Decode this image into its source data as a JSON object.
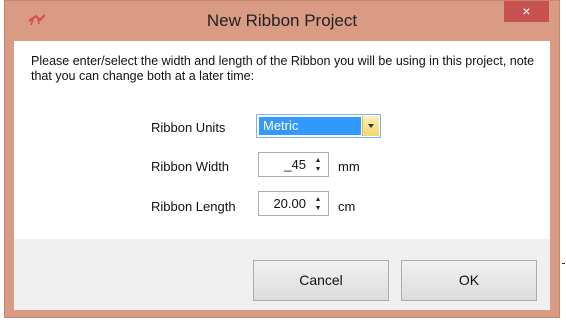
{
  "window": {
    "title": "New Ribbon Project",
    "close_label": "×",
    "frame_color": "#d99b83",
    "close_color": "#c75050"
  },
  "instructions": "Please enter/select the width and length of the Ribbon you will be using in this project, note that you can change both at a later time:",
  "form": {
    "units": {
      "label": "Ribbon Units",
      "value": "Metric"
    },
    "width": {
      "label": "Ribbon Width",
      "value": "_45",
      "unit": "mm"
    },
    "length": {
      "label": "Ribbon Length",
      "value": "20.00",
      "unit": "cm"
    }
  },
  "buttons": {
    "cancel": "Cancel",
    "ok": "OK"
  },
  "icons": {
    "app": "ribbon-app-icon",
    "close": "close-icon",
    "dropdown": "chevron-down-icon",
    "spin_up": "spin-up-icon",
    "spin_down": "spin-down-icon"
  }
}
